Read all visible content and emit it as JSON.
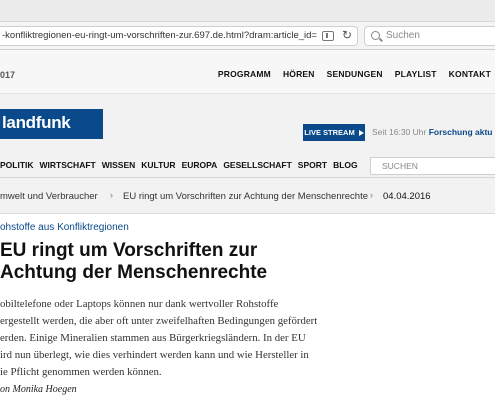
{
  "browser": {
    "url": "-konfliktregionen-eu-ringt-um-vorschriften-zur.697.de.html?dram:article_id=350252",
    "search_placeholder": "Suchen"
  },
  "topnav": {
    "year": "017",
    "links": [
      "PROGRAMM",
      "HÖREN",
      "SENDUNGEN",
      "PLAYLIST",
      "KONTAKT"
    ]
  },
  "logo": {
    "text": "landfunk"
  },
  "livestream": {
    "label": "LIVE STREAM",
    "info": "Seit 16:30 Uhr",
    "link": "Forschung aktu"
  },
  "section_nav": {
    "items": [
      "POLITIK",
      "WIRTSCHAFT",
      "WISSEN",
      "KULTUR",
      "EUROPA",
      "GESELLSCHAFT",
      "SPORT",
      "BLOG"
    ],
    "search_placeholder": "SUCHEN"
  },
  "breadcrumb": {
    "items": [
      "mwelt und Verbraucher",
      "EU ringt um Vorschriften zur Achtung der Menschenrechte"
    ],
    "date": "04.04.2016"
  },
  "article": {
    "kicker": "ohstoffe aus Konfliktregionen",
    "headline_lines": [
      "EU ringt um Vorschriften zur",
      "Achtung der Menschenrechte"
    ],
    "teaser_lines": [
      "obiltelefone oder Laptops können nur dank wertvoller Rohstoffe",
      "ergestellt werden, die aber oft unter zweifelhaften Bedingungen gefördert",
      "erden. Einige Mineralien stammen aus Bürgerkriegsländern. In der EU",
      "ird nun überlegt, wie dies verhindert werden kann und wie Hersteller in",
      "ie Pflicht genommen werden können."
    ],
    "author": "on Monika Hoegen"
  },
  "colors": {
    "brand": "#0a4a8a"
  }
}
